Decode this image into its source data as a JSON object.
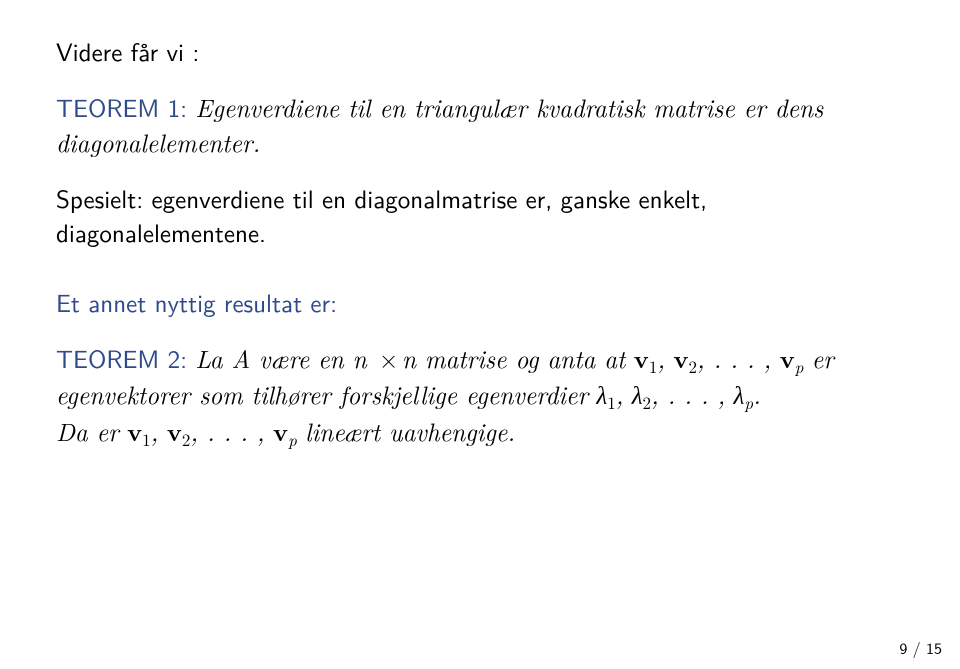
{
  "intro": "Videre får vi :",
  "theorem1": {
    "label": "TEOREM 1:",
    "text": "Egenverdiene til en triangulær kvadratisk matrise er dens diagonalelementer."
  },
  "spesielt": "Spesielt: egenverdiene til en diagonalmatrise er, ganske enkelt, diagonalelementene.",
  "lead2": "Et annet nyttig resultat er:",
  "theorem2": {
    "label": "TEOREM 2:",
    "pre": "La A være en n",
    "mid": "n matrise og anta at",
    "post1": "er egenvektorer som tilhører forskjellige egenverdier",
    "post2": "Da er",
    "post3": "lineært uavhengige."
  },
  "sym": {
    "v": "v",
    "lambda": "λ",
    "dots": ", . . . ,",
    "comma": ",",
    "period": ".",
    "times": "×",
    "sub1": "1",
    "sub2": "2",
    "subp": "p"
  },
  "footer": "9 / 15"
}
